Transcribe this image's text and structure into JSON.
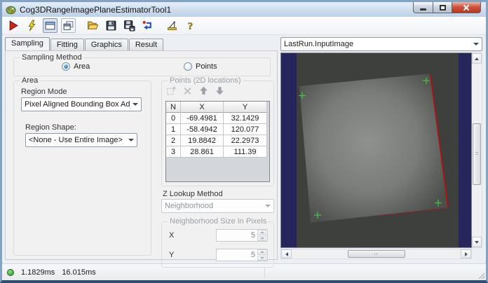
{
  "window": {
    "title": "Cog3DRangeImagePlaneEstimatorTool1",
    "buttons": [
      "minimize",
      "maximize",
      "close"
    ]
  },
  "toolbar": {
    "icons": [
      "run",
      "electric-run",
      "show-image-display",
      "floating-image-display",
      "open",
      "save",
      "save-as",
      "reset",
      "plane-tool",
      "help"
    ],
    "help_glyph": "?"
  },
  "tabs": {
    "items": [
      "Sampling",
      "Fitting",
      "Graphics",
      "Result"
    ],
    "active": "Sampling"
  },
  "sampling": {
    "group_label": "Sampling Method",
    "area_label": "Area",
    "points_label": "Points",
    "selected": "Area"
  },
  "area": {
    "group_label": "Area",
    "region_mode_label": "Region Mode",
    "region_mode_value": "Pixel Aligned Bounding Box Adjust Mask",
    "region_shape_label": "Region Shape:",
    "region_shape_value": "<None - Use Entire Image>"
  },
  "points": {
    "group_label": "Points (2D locations)",
    "toolbar_icons": [
      "add-point",
      "delete-point",
      "move-up",
      "move-down"
    ],
    "table": {
      "columns": [
        "N",
        "X",
        "Y"
      ],
      "rows": [
        [
          "0",
          "-69.4981",
          "32.1429"
        ],
        [
          "1",
          "-58.4942",
          "120.077"
        ],
        [
          "2",
          "19.8842",
          "22.2973"
        ],
        [
          "3",
          "28.861",
          "111.39"
        ]
      ]
    }
  },
  "z_lookup": {
    "label": "Z Lookup Method",
    "value": "Neighborhood"
  },
  "neighborhood": {
    "group_label": "Neighborhood Size In Pixels",
    "x_label": "X",
    "x_value": "5",
    "y_label": "Y",
    "y_value": "5"
  },
  "display": {
    "source": "LastRun.InputImage",
    "overlay": {
      "cross_color": "#44c144",
      "edge_color": "#a11616",
      "square": [
        [
          26,
          48
        ],
        [
          212,
          30
        ],
        [
          238,
          226
        ],
        [
          42,
          248
        ]
      ],
      "crosses": [
        [
          30,
          62
        ],
        [
          207,
          40
        ],
        [
          52,
          237
        ],
        [
          224,
          219
        ]
      ]
    }
  },
  "status": {
    "time1": "1.1829ms",
    "time2": "16.015ms"
  },
  "colors": {
    "titlebar_top": "#e3edf8",
    "titlebar_bottom": "#bdd1e6",
    "close_red": "#d0533b",
    "navy": "#26265c",
    "image_bg": "#3d403d",
    "status_green": "#2f9230"
  }
}
